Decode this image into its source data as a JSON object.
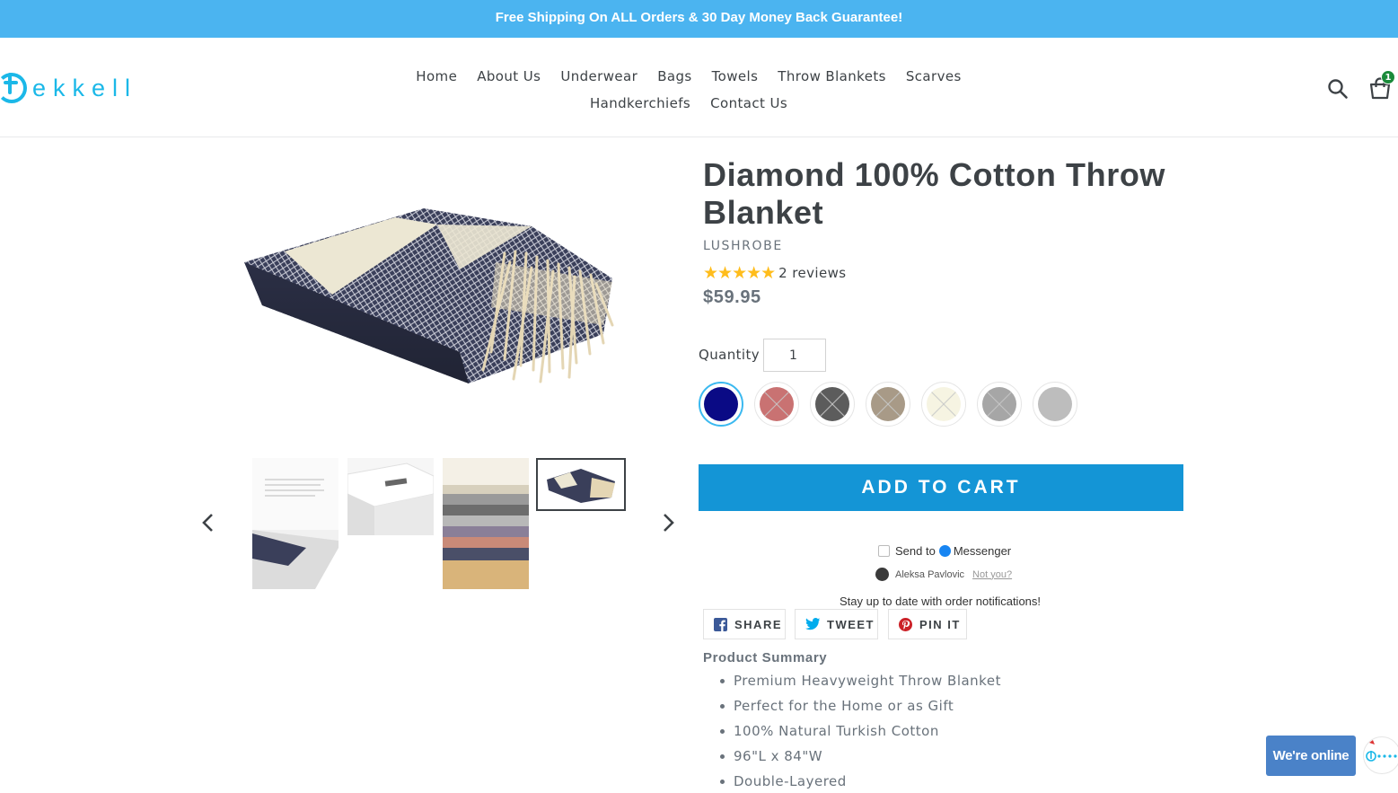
{
  "announcement": "Free Shipping On ALL Orders & 30 Day Money Back Guarantee!",
  "brand": {
    "logo_text": "ekkell"
  },
  "nav": {
    "items": [
      "Home",
      "About Us",
      "Underwear",
      "Bags",
      "Towels",
      "Throw Blankets",
      "Scarves",
      "Handkerchiefs",
      "Contact Us"
    ]
  },
  "header": {
    "search_icon": "search-icon",
    "cart_icon": "cart-icon",
    "cart_count": "1"
  },
  "product": {
    "title": "Diamond 100% Cotton Throw Blanket",
    "vendor": "LUSHROBE",
    "rating": 5,
    "stars": "★★★★★",
    "reviews": "2 reviews",
    "price": "$59.95",
    "quantity_label": "Quantity",
    "quantity_value": "1",
    "add_to_cart": "ADD TO CART"
  },
  "swatches": [
    {
      "color": "#0a0a85",
      "available": true,
      "selected": true
    },
    {
      "color": "#c97272",
      "available": false,
      "selected": false
    },
    {
      "color": "#5c5c5c",
      "available": false,
      "selected": false
    },
    {
      "color": "#a89a87",
      "available": false,
      "selected": false
    },
    {
      "color": "#f6f4e2",
      "available": false,
      "selected": false
    },
    {
      "color": "#a6a6a6",
      "available": false,
      "selected": false
    },
    {
      "color": "#bdbdbd",
      "available": true,
      "selected": false
    }
  ],
  "messenger": {
    "send_to": "Send to",
    "messenger_label": "Messenger",
    "user_name": "Aleksa Pavlovic",
    "not_you": "Not you?",
    "stay_updated": "Stay up to date with order notifications!"
  },
  "share": {
    "facebook": "SHARE",
    "twitter": "TWEET",
    "pinterest": "PIN IT"
  },
  "summary": {
    "heading": "Product Summary",
    "items": [
      "Premium Heavyweight Throw Blanket",
      "Perfect for the Home or as Gift",
      "100% Natural Turkish Cotton",
      "96\"L x 84\"W",
      "Double-Layered"
    ]
  },
  "chat": {
    "label": "We're online"
  },
  "colors": {
    "accent": "#1495d6",
    "announcement_bg": "#4bb4f0",
    "brand": "#1bb8e8",
    "star": "#ffbd1c"
  }
}
